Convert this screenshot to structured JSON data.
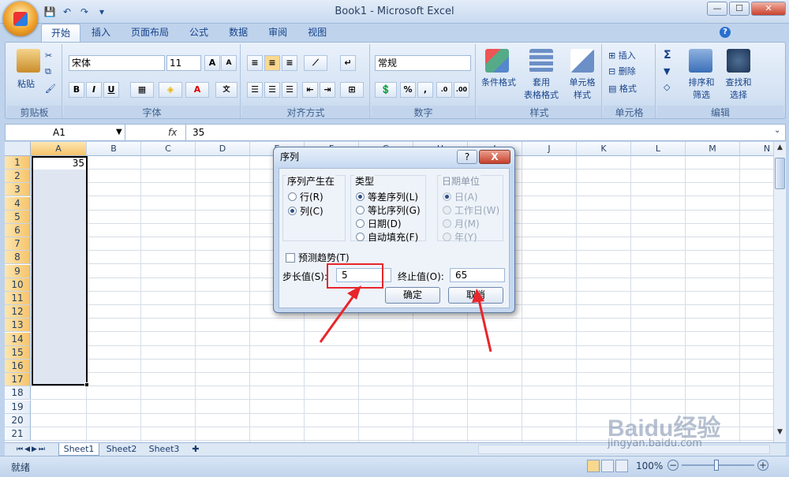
{
  "window": {
    "title": "Book1 - Microsoft Excel",
    "minimize": "—",
    "maximize": "☐",
    "close": "✕",
    "help": "?"
  },
  "qat": {
    "save": "💾",
    "undo": "↶",
    "redo": "↷",
    "customize": "▾"
  },
  "tabs": [
    "开始",
    "插入",
    "页面布局",
    "公式",
    "数据",
    "审阅",
    "视图"
  ],
  "ribbon": {
    "clipboard": {
      "label": "剪贴板",
      "paste": "粘贴"
    },
    "font": {
      "label": "字体",
      "name": "宋体",
      "size": "11",
      "grow": "A",
      "shrink": "A",
      "bold": "B",
      "italic": "I",
      "underline": "U"
    },
    "alignment": {
      "label": "对齐方式"
    },
    "number": {
      "label": "数字",
      "format": "常规",
      "percent": "%",
      "comma": ","
    },
    "styles": {
      "label": "样式",
      "conditional": "条件格式",
      "table1": "套用",
      "table2": "表格格式",
      "cell1": "单元格",
      "cell2": "样式"
    },
    "cells": {
      "label": "单元格",
      "insert": "插入",
      "delete": "删除",
      "format": "格式"
    },
    "editing": {
      "label": "编辑",
      "sort1": "排序和",
      "sort2": "筛选",
      "find1": "查找和",
      "find2": "选择"
    }
  },
  "formula_bar": {
    "name_box": "A1",
    "fx": "fx",
    "value": "35"
  },
  "grid": {
    "columns": [
      "A",
      "B",
      "C",
      "D",
      "E",
      "F",
      "G",
      "H",
      "I",
      "J",
      "K",
      "L",
      "M",
      "N"
    ],
    "rows": [
      "1",
      "2",
      "3",
      "4",
      "5",
      "6",
      "7",
      "8",
      "9",
      "10",
      "11",
      "12",
      "13",
      "14",
      "15",
      "16",
      "17",
      "18",
      "19",
      "20",
      "21"
    ],
    "a1_value": "35"
  },
  "sheets": [
    "Sheet1",
    "Sheet2",
    "Sheet3"
  ],
  "status": {
    "ready": "就绪",
    "zoom": "100%"
  },
  "dialog": {
    "title": "序列",
    "help": "?",
    "close": "X",
    "series_in": {
      "label": "序列产生在",
      "rows": "行(R)",
      "cols": "列(C)",
      "selected": "cols"
    },
    "type": {
      "label": "类型",
      "linear": "等差序列(L)",
      "growth": "等比序列(G)",
      "date": "日期(D)",
      "autofill": "自动填充(F)",
      "selected": "linear"
    },
    "date_unit": {
      "label": "日期单位",
      "day": "日(A)",
      "weekday": "工作日(W)",
      "month": "月(M)",
      "year": "年(Y)"
    },
    "trend": "预测趋势(T)",
    "step_label": "步长值(S):",
    "step_value": "5",
    "stop_label": "终止值(O):",
    "stop_value": "65",
    "ok": "确定",
    "cancel": "取消"
  },
  "watermark": {
    "brand": "Baidu经验",
    "url": "jingyan.baidu.com"
  }
}
